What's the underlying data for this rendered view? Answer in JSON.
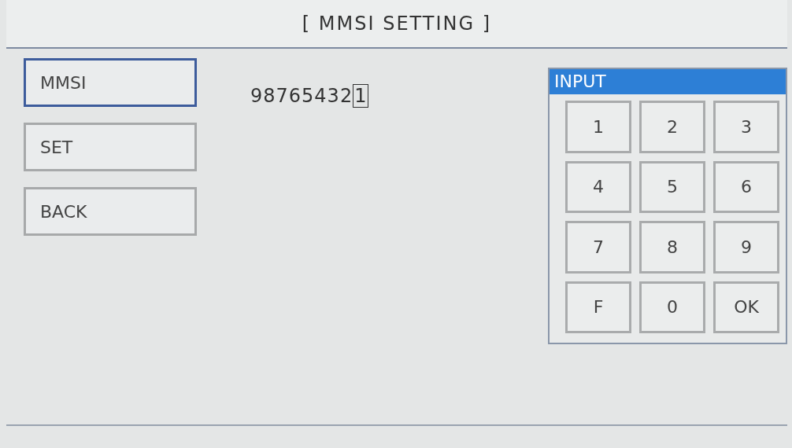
{
  "title": "[ MMSI SETTING ]",
  "menu": [
    {
      "label": "MMSI",
      "selected": true
    },
    {
      "label": "SET",
      "selected": false
    },
    {
      "label": "BACK",
      "selected": false
    }
  ],
  "mmsi_field": {
    "value_before_cursor": "98765432",
    "cursor_char": "1"
  },
  "keypad": {
    "title": "INPUT",
    "keys": [
      "1",
      "2",
      "3",
      "4",
      "5",
      "6",
      "7",
      "8",
      "9",
      "F",
      "0",
      "OK"
    ]
  }
}
